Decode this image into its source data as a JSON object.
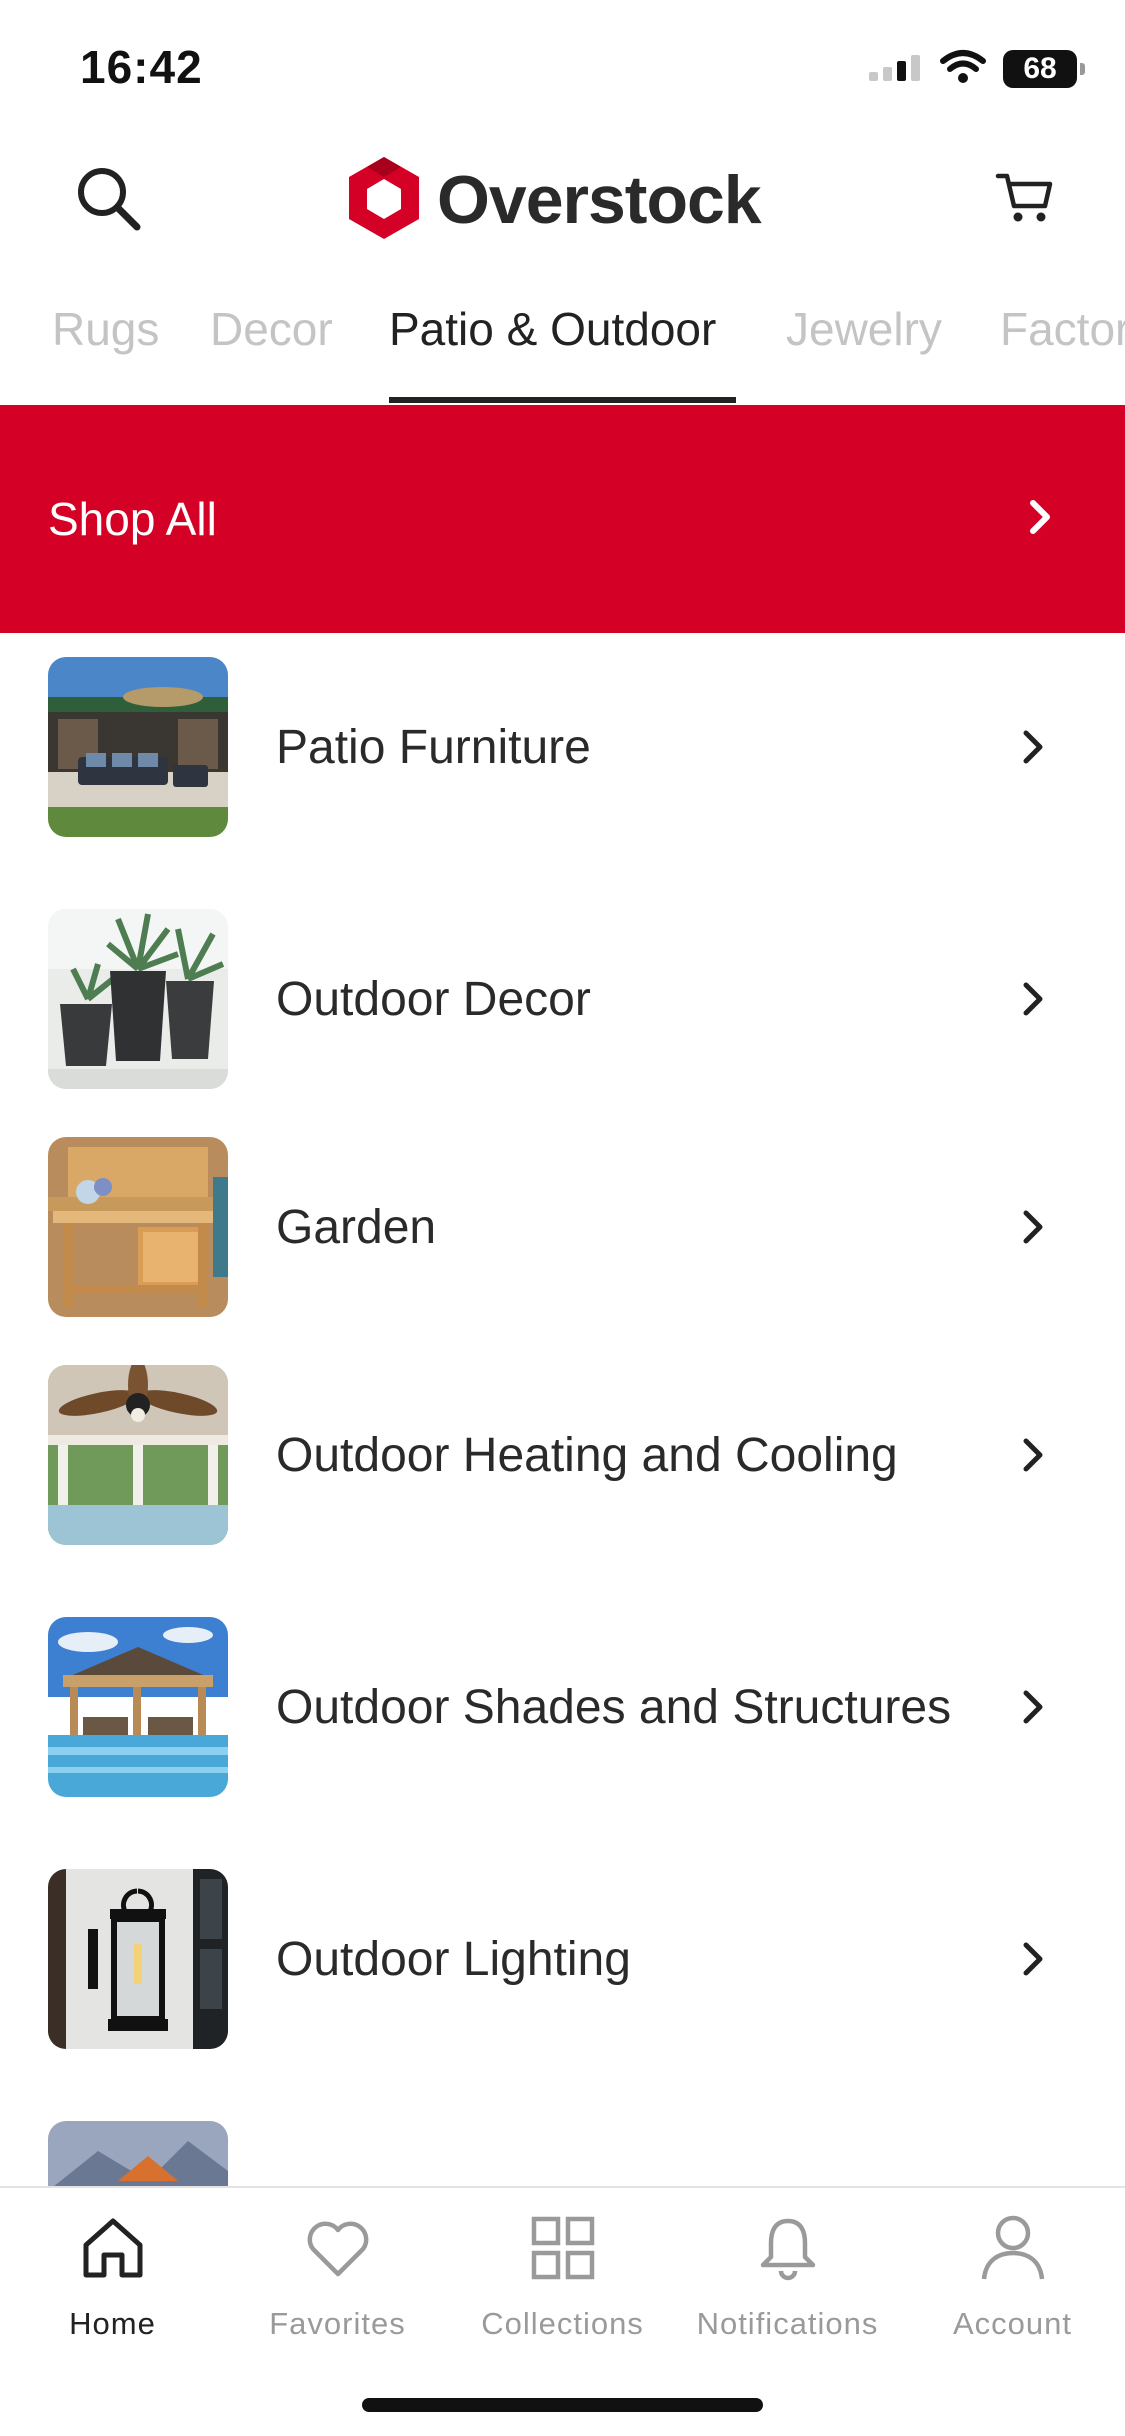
{
  "status_bar": {
    "time": "16:42",
    "battery": "68"
  },
  "header": {
    "search_icon": "search-icon",
    "logo_text": "Overstock",
    "cart_icon": "cart-icon",
    "brand_color": "#d50025"
  },
  "tabs": [
    {
      "label": "Rugs",
      "active": false
    },
    {
      "label": "Decor",
      "active": false
    },
    {
      "label": "Patio & Outdoor",
      "active": true
    },
    {
      "label": "Jewelry",
      "active": false
    },
    {
      "label": "Factory",
      "active": false
    }
  ],
  "shop_all": {
    "label": "Shop All"
  },
  "categories": [
    {
      "label": "Patio Furniture"
    },
    {
      "label": "Outdoor Decor"
    },
    {
      "label": "Garden"
    },
    {
      "label": "Outdoor Heating and Cooling"
    },
    {
      "label": "Outdoor Shades and Structures"
    },
    {
      "label": "Outdoor Lighting"
    }
  ],
  "bottom_nav": [
    {
      "label": "Home",
      "icon": "home-icon",
      "active": true
    },
    {
      "label": "Favorites",
      "icon": "heart-icon",
      "active": false
    },
    {
      "label": "Collections",
      "icon": "grid-icon",
      "active": false
    },
    {
      "label": "Notifications",
      "icon": "bell-icon",
      "active": false
    },
    {
      "label": "Account",
      "icon": "person-icon",
      "active": false
    }
  ]
}
